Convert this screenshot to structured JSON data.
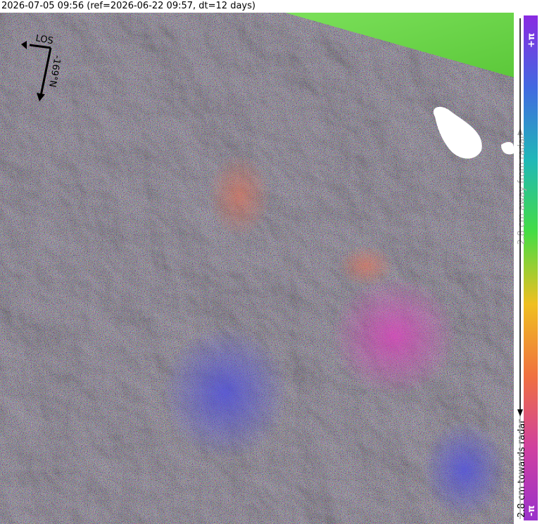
{
  "title": "2026-07-05 09:56 (ref=2026-06-22 09:57, dt=12 days)",
  "overlay": {
    "los_label": "LOS",
    "heading_label": "-169°N"
  },
  "colorbar": {
    "top_label": "+π",
    "bottom_label": "-π",
    "away_label": "2.8 cm away from radar",
    "towards_label": "2.8 cm towards radar",
    "stops": [
      "#8a2be2",
      "#4169e1",
      "#1fb8b8",
      "#44dd44",
      "#f0c020",
      "#f07040",
      "#d040a0",
      "#9932cc"
    ]
  },
  "colors": {
    "terrain_green": "#6cd84a",
    "mask_white": "#ffffff",
    "interferogram_base": "#7a6e8a"
  }
}
